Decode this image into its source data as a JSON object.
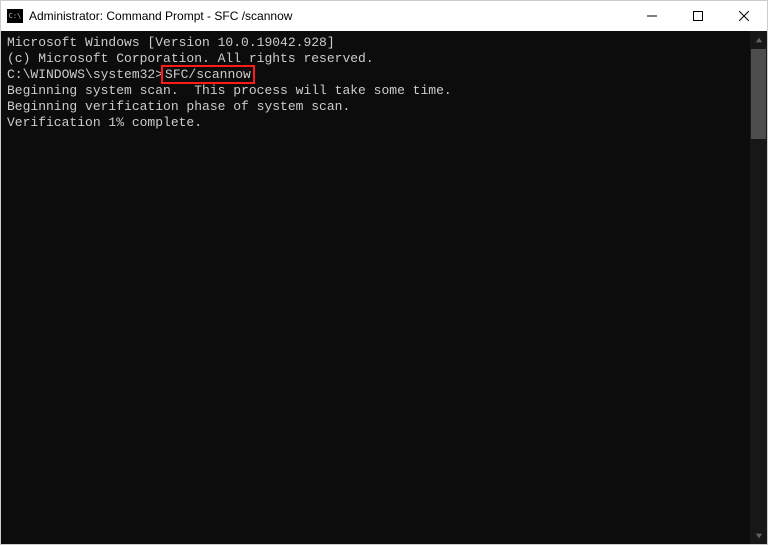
{
  "titlebar": {
    "title": "Administrator: Command Prompt - SFC /scannow"
  },
  "terminal": {
    "line1": "Microsoft Windows [Version 10.0.19042.928]",
    "line2": "(c) Microsoft Corporation. All rights reserved.",
    "blank1": "",
    "prompt_path": "C:\\WINDOWS\\system32>",
    "prompt_command": "SFC/scannow",
    "blank2": "",
    "line3": "Beginning system scan.  This process will take some time.",
    "blank3": "",
    "line4": "Beginning verification phase of system scan.",
    "line5": "Verification 1% complete."
  }
}
